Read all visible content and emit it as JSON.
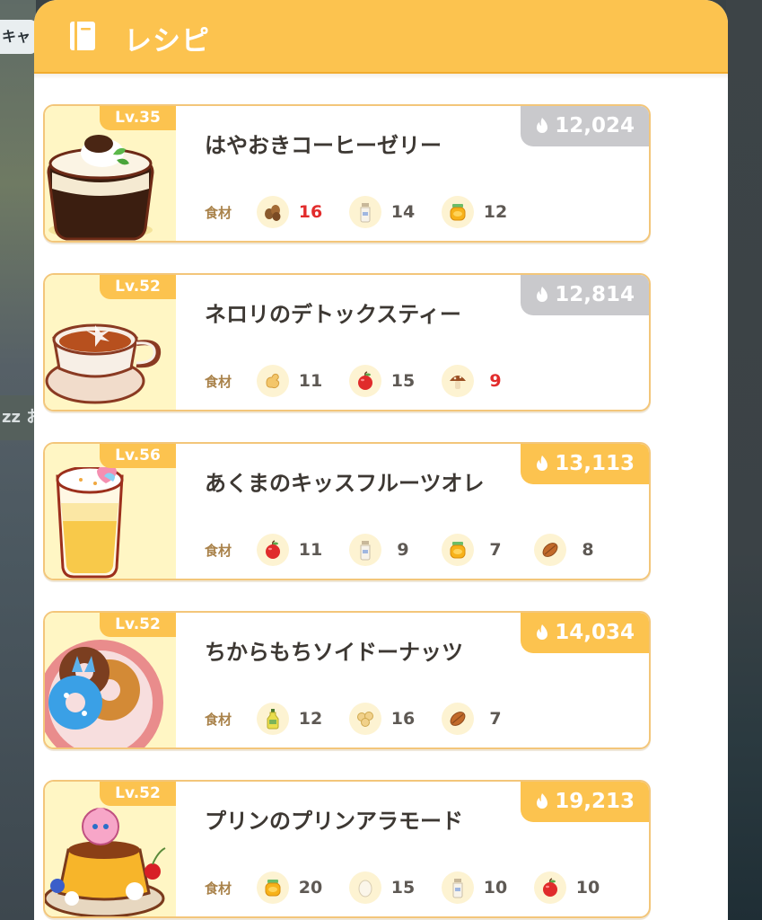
{
  "background": {
    "left_tab_top": "キャ",
    "left_tab_mid": "zz お"
  },
  "header": {
    "title": "レシピ",
    "icon": "book-icon"
  },
  "ingredients_label": "食材",
  "colors": {
    "header": "#fcc34f",
    "energy_available": "#fcc34f",
    "energy_unavailable": "#c9c9cc",
    "insufficient_qty": "#e22c2c"
  },
  "recipes": [
    {
      "level": "Lv.35",
      "name": "はやおきコーヒーゼリー",
      "energy": "12,024",
      "energy_state": "unavailable",
      "food": "coffee-jelly",
      "ingredients": [
        {
          "icon": "roasted-cacao-icon",
          "qty": "16",
          "insufficient": true
        },
        {
          "icon": "moomoo-milk-icon",
          "qty": "14",
          "insufficient": false
        },
        {
          "icon": "honey-icon",
          "qty": "12",
          "insufficient": false
        }
      ]
    },
    {
      "level": "Lv.52",
      "name": "ネロリのデトックスティー",
      "energy": "12,814",
      "energy_state": "unavailable",
      "food": "tea",
      "ingredients": [
        {
          "icon": "ginger-icon",
          "qty": "11",
          "insufficient": false
        },
        {
          "icon": "apple-icon",
          "qty": "15",
          "insufficient": false
        },
        {
          "icon": "mushroom-icon",
          "qty": "9",
          "insufficient": true
        }
      ]
    },
    {
      "level": "Lv.56",
      "name": "あくまのキッスフルーツオレ",
      "energy": "13,113",
      "energy_state": "available",
      "food": "fruit-milk",
      "ingredients": [
        {
          "icon": "apple-icon",
          "qty": "11",
          "insufficient": false
        },
        {
          "icon": "moomoo-milk-icon",
          "qty": "9",
          "insufficient": false
        },
        {
          "icon": "honey-icon",
          "qty": "7",
          "insufficient": false
        },
        {
          "icon": "cacao-icon",
          "qty": "8",
          "insufficient": false
        }
      ]
    },
    {
      "level": "Lv.52",
      "name": "ちからもちソイドーナッツ",
      "energy": "14,034",
      "energy_state": "available",
      "food": "donuts",
      "ingredients": [
        {
          "icon": "oil-icon",
          "qty": "12",
          "insufficient": false
        },
        {
          "icon": "soybeans-icon",
          "qty": "16",
          "insufficient": false
        },
        {
          "icon": "cacao-icon",
          "qty": "7",
          "insufficient": false
        }
      ]
    },
    {
      "level": "Lv.52",
      "name": "プリンのプリンアラモード",
      "energy": "19,213",
      "energy_state": "available",
      "food": "pudding",
      "ingredients": [
        {
          "icon": "honey-icon",
          "qty": "20",
          "insufficient": false
        },
        {
          "icon": "egg-icon",
          "qty": "15",
          "insufficient": false
        },
        {
          "icon": "moomoo-milk-icon",
          "qty": "10",
          "insufficient": false
        },
        {
          "icon": "apple-icon",
          "qty": "10",
          "insufficient": false
        }
      ]
    }
  ]
}
